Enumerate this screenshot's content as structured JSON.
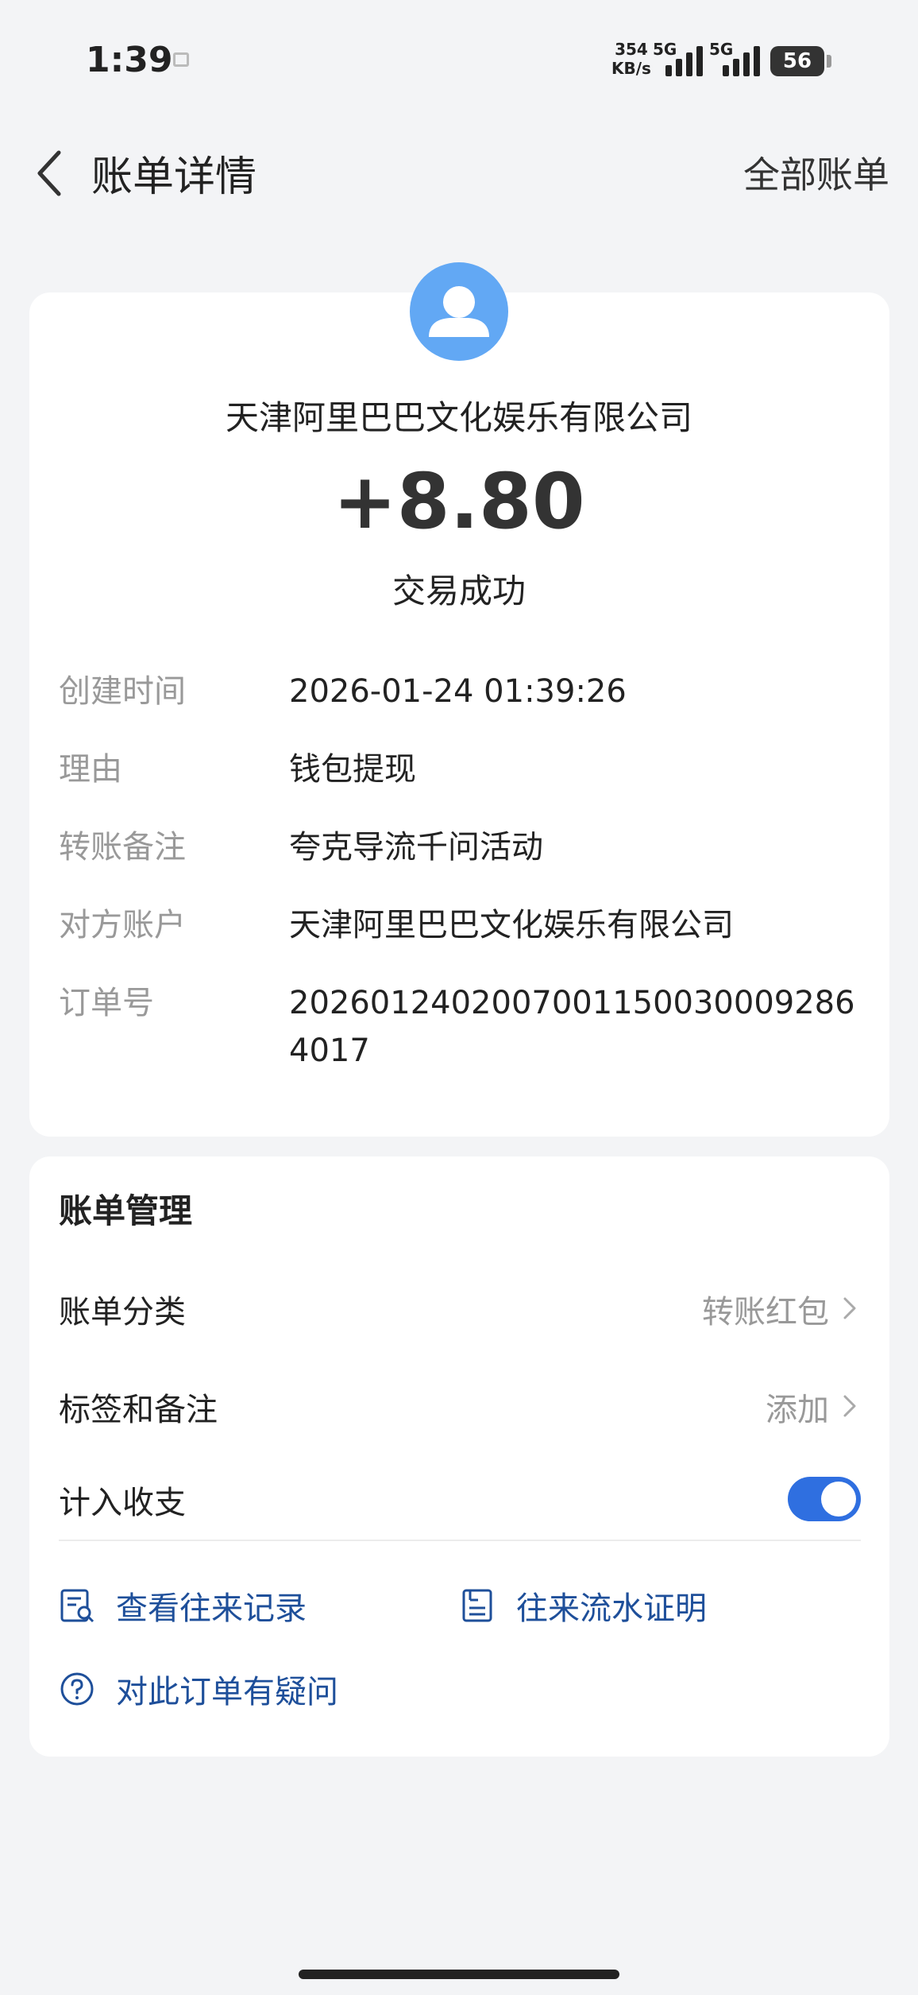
{
  "status_bar": {
    "time": "1:39",
    "speed_value": "354",
    "speed_unit": "KB/s",
    "net1": "5G",
    "net2": "5G",
    "battery": "56"
  },
  "header": {
    "title": "账单详情",
    "right_link": "全部账单"
  },
  "summary": {
    "merchant": "天津阿里巴巴文化娱乐有限公司",
    "amount": "+8.80",
    "status": "交易成功"
  },
  "details": [
    {
      "label": "创建时间",
      "value": "2026-01-24 01:39:26"
    },
    {
      "label": "理由",
      "value": "钱包提现"
    },
    {
      "label": "转账备注",
      "value": "夸克导流千问活动"
    },
    {
      "label": "对方账户",
      "value": "天津阿里巴巴文化娱乐有限公司"
    },
    {
      "label": "订单号",
      "value": "20260124020070011500300092864017"
    }
  ],
  "management": {
    "title": "账单管理",
    "category_label": "账单分类",
    "category_value": "转账红包",
    "tags_label": "标签和备注",
    "tags_value": "添加",
    "count_label": "计入收支",
    "count_enabled": true
  },
  "links": {
    "records": "查看往来记录",
    "proof": "往来流水证明",
    "question": "对此订单有疑问"
  },
  "colors": {
    "accent": "#2f6fe0",
    "link": "#1e4f9a",
    "avatar": "#62a8f4"
  }
}
